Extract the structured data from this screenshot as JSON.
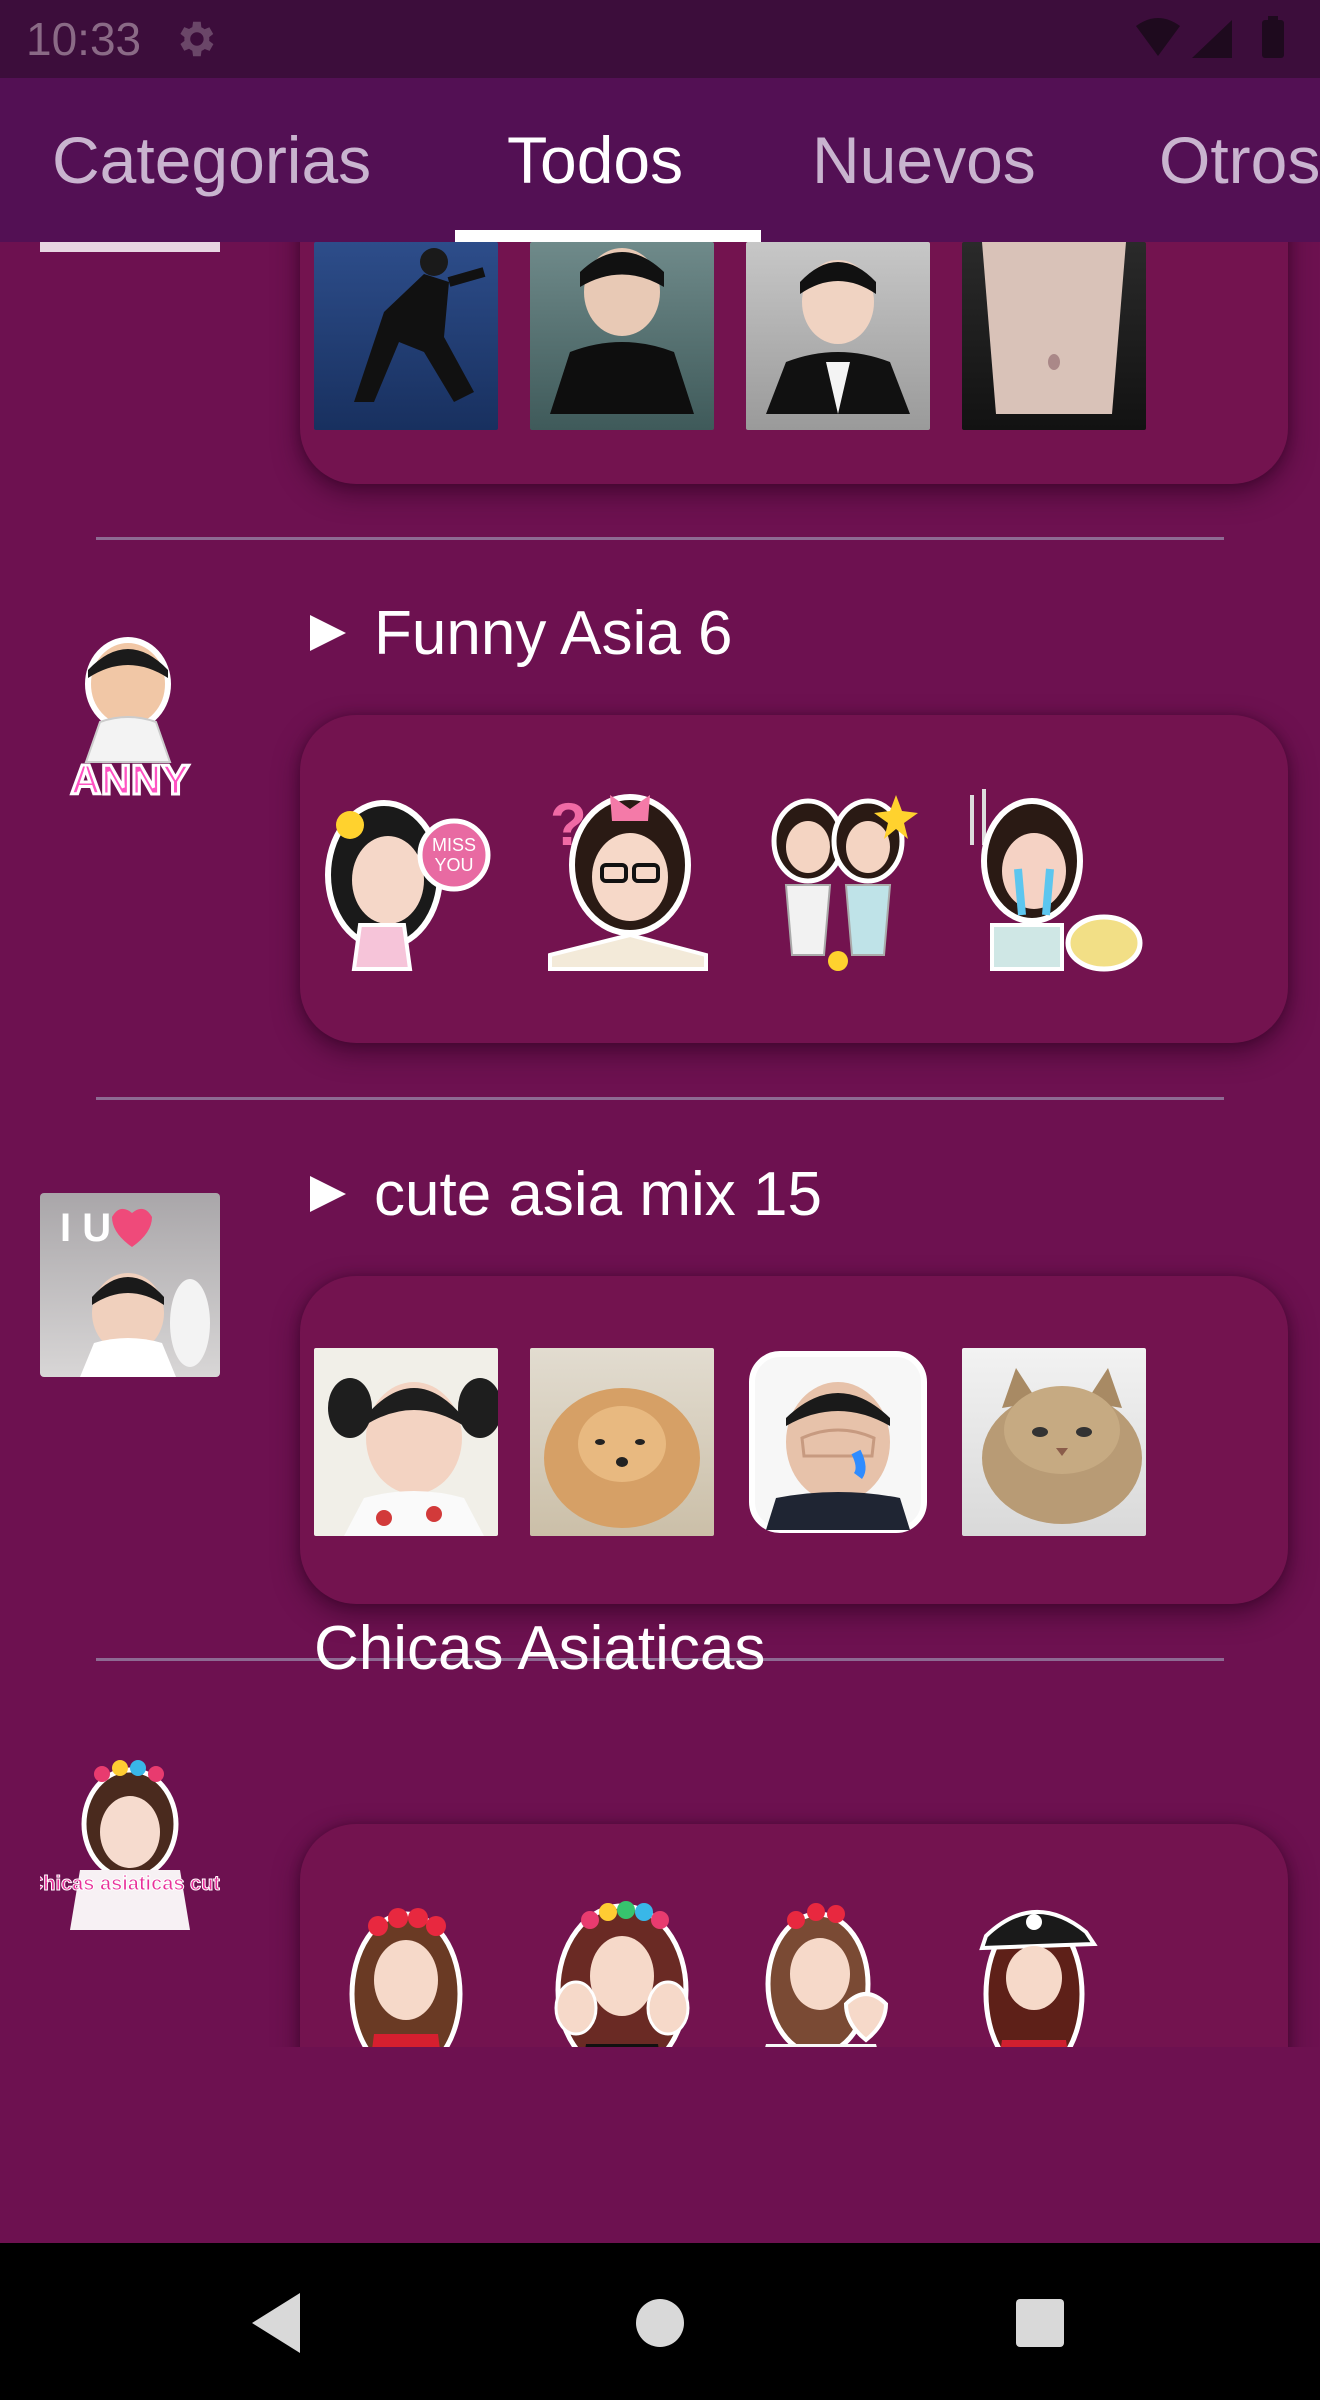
{
  "status": {
    "time": "10:33",
    "icons": [
      "gear-icon",
      "wifi-icon",
      "signal-icon",
      "battery-icon"
    ]
  },
  "tabs": [
    {
      "label": "Categorias",
      "active": false
    },
    {
      "label": "Todos",
      "active": true
    },
    {
      "label": "Nuevos",
      "active": false
    },
    {
      "label": "Otros",
      "active": false
    }
  ],
  "packs": [
    {
      "title": "",
      "has_play": false,
      "thumbs": [
        "dancer-photo",
        "man-on-couch-photo",
        "man-smiling-photo",
        "torso-photo"
      ]
    },
    {
      "title": "Funny Asia 6",
      "has_play": true,
      "icon_text": "ANNY",
      "thumbs": [
        "miss-you-sticker",
        "reading-girl-sticker",
        "two-girls-sticker",
        "crying-girl-sticker"
      ]
    },
    {
      "title": "cute asia mix 15",
      "has_play": true,
      "icon_text": "I U",
      "thumbs": [
        "girl-pigtails-photo",
        "pomeranian-photo",
        "crying-boy-sticker",
        "cat-photo"
      ]
    },
    {
      "title": "Chicas Asiaticas",
      "has_play": false,
      "icon_text": "Chicas asiaticas cute",
      "thumbs": [
        "flower-crown-girl-sticker",
        "hands-girl-sticker",
        "heart-hands-girl-sticker",
        "cap-girl-sticker"
      ]
    }
  ],
  "colors": {
    "background": "#6d1150",
    "panel": "#73134f",
    "tab_bar": "#531054",
    "status_bar": "#3c0d3b",
    "divider": "#8e6b93"
  },
  "nav": [
    "back-icon",
    "home-icon",
    "recents-icon"
  ]
}
